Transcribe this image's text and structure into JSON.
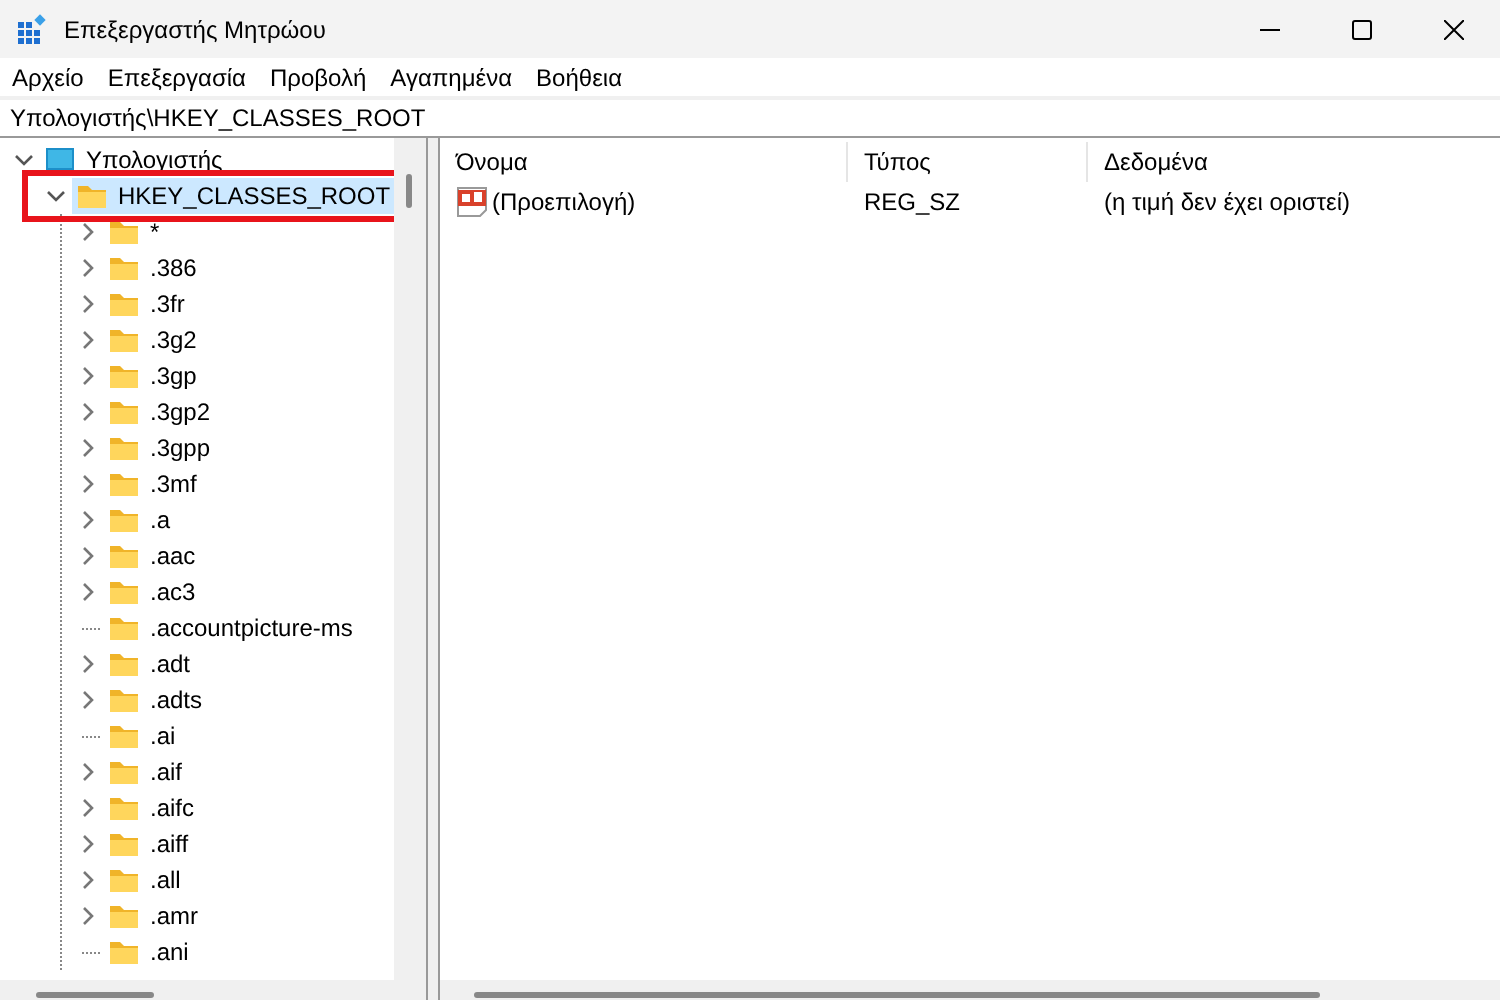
{
  "window": {
    "title": "Επεξεργαστής Μητρώου"
  },
  "menu": [
    "Αρχείο",
    "Επεξεργασία",
    "Προβολή",
    "Αγαπημένα",
    "Βοήθεια"
  ],
  "address": "Υπολογιστής\\HKEY_CLASSES_ROOT",
  "tree": [
    {
      "label": "Υπολογιστής",
      "kind": "computer",
      "expanded": true,
      "selected": false,
      "children": [
        {
          "label": "HKEY_CLASSES_ROOT",
          "kind": "folder",
          "expanded": true,
          "selected": true,
          "highlighted": true,
          "children": [
            {
              "label": "*",
              "kind": "folder",
              "expandable": true,
              "selected": false
            },
            {
              "label": ".386",
              "kind": "folder",
              "expandable": true,
              "selected": false
            },
            {
              "label": ".3fr",
              "kind": "folder",
              "expandable": true,
              "selected": false
            },
            {
              "label": ".3g2",
              "kind": "folder",
              "expandable": true,
              "selected": false
            },
            {
              "label": ".3gp",
              "kind": "folder",
              "expandable": true,
              "selected": false
            },
            {
              "label": ".3gp2",
              "kind": "folder",
              "expandable": true,
              "selected": false
            },
            {
              "label": ".3gpp",
              "kind": "folder",
              "expandable": true,
              "selected": false
            },
            {
              "label": ".3mf",
              "kind": "folder",
              "expandable": true,
              "selected": false
            },
            {
              "label": ".a",
              "kind": "folder",
              "expandable": true,
              "selected": false
            },
            {
              "label": ".aac",
              "kind": "folder",
              "expandable": true,
              "selected": false
            },
            {
              "label": ".ac3",
              "kind": "folder",
              "expandable": true,
              "selected": false
            },
            {
              "label": ".accountpicture-ms",
              "kind": "folder",
              "expandable": false,
              "selected": false
            },
            {
              "label": ".adt",
              "kind": "folder",
              "expandable": true,
              "selected": false
            },
            {
              "label": ".adts",
              "kind": "folder",
              "expandable": true,
              "selected": false
            },
            {
              "label": ".ai",
              "kind": "folder",
              "expandable": false,
              "selected": false
            },
            {
              "label": ".aif",
              "kind": "folder",
              "expandable": true,
              "selected": false
            },
            {
              "label": ".aifc",
              "kind": "folder",
              "expandable": true,
              "selected": false
            },
            {
              "label": ".aiff",
              "kind": "folder",
              "expandable": true,
              "selected": false
            },
            {
              "label": ".all",
              "kind": "folder",
              "expandable": true,
              "selected": false
            },
            {
              "label": ".amr",
              "kind": "folder",
              "expandable": true,
              "selected": false
            },
            {
              "label": ".ani",
              "kind": "folder",
              "expandable": false,
              "selected": false
            }
          ]
        }
      ]
    }
  ],
  "values": {
    "columns": [
      "Όνομα",
      "Τύπος",
      "Δεδομένα"
    ],
    "rows": [
      {
        "name": "(Προεπιλογή)",
        "type": "REG_SZ",
        "data": "(η τιμή δεν έχει οριστεί)",
        "selected": false
      }
    ]
  }
}
